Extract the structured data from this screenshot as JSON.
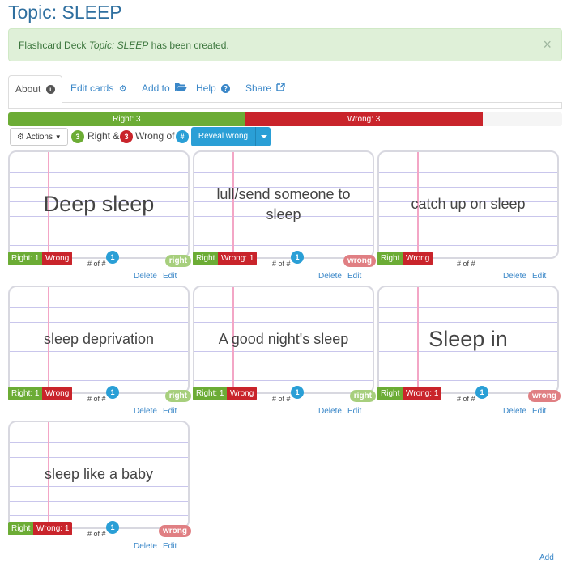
{
  "page": {
    "title": "Topic: SLEEP"
  },
  "alert": {
    "prefix": "Flashcard Deck ",
    "deck_name": "Topic: SLEEP",
    "suffix": " has been created.",
    "close": "×"
  },
  "tabs": [
    {
      "label": "About",
      "icon": "info-icon"
    },
    {
      "label": "Edit cards",
      "icon": "gear-icon"
    },
    {
      "label": "Add to",
      "icon": "folder-open-icon"
    },
    {
      "label": "Help",
      "icon": "question-icon"
    },
    {
      "label": "Share",
      "icon": "external-link-icon"
    }
  ],
  "progress": {
    "right_label": "Right: 3",
    "right_fraction": 0.428,
    "wrong_label": "Wrong: 3",
    "wrong_fraction": 0.428
  },
  "toolbar": {
    "actions_label": "Actions",
    "right_count": "3",
    "right_text": "Right &",
    "wrong_count": "3",
    "wrong_text": "Wrong of",
    "total_badge": "#",
    "reveal_label": "Reveal wrong"
  },
  "cards": [
    {
      "text": "Deep sleep",
      "right": "Right: 1",
      "wrong": "Wrong",
      "of": "# of #",
      "badge": "1",
      "status": "right",
      "delete": "Delete",
      "edit": "Edit"
    },
    {
      "text": "lull/send someone to sleep",
      "right": "Right",
      "wrong": "Wrong: 1",
      "of": "# of #",
      "badge": "1",
      "status": "wrong",
      "delete": "Delete",
      "edit": "Edit"
    },
    {
      "text": "catch up on sleep",
      "right": "Right",
      "wrong": "Wrong",
      "of": "# of #",
      "badge": "",
      "status": "",
      "delete": "Delete",
      "edit": "Edit"
    },
    {
      "text": "sleep deprivation",
      "right": "Right: 1",
      "wrong": "Wrong",
      "of": "# of #",
      "badge": "1",
      "status": "right",
      "delete": "Delete",
      "edit": "Edit"
    },
    {
      "text": "A good night's sleep",
      "right": "Right: 1",
      "wrong": "Wrong",
      "of": "# of #",
      "badge": "1",
      "status": "right",
      "delete": "Delete",
      "edit": "Edit"
    },
    {
      "text": "Sleep in",
      "right": "Right",
      "wrong": "Wrong: 1",
      "of": "# of #",
      "badge": "1",
      "status": "wrong",
      "delete": "Delete",
      "edit": "Edit"
    },
    {
      "text": "sleep like a baby",
      "right": "Right",
      "wrong": "Wrong: 1",
      "of": "# of #",
      "badge": "1",
      "status": "wrong",
      "delete": "Delete",
      "edit": "Edit"
    }
  ],
  "footer": {
    "add_label": "Add"
  },
  "colors": {
    "right": "#6cac35",
    "wrong": "#c9242b",
    "accent": "#2a9fd6",
    "title": "#2f6f9f"
  }
}
